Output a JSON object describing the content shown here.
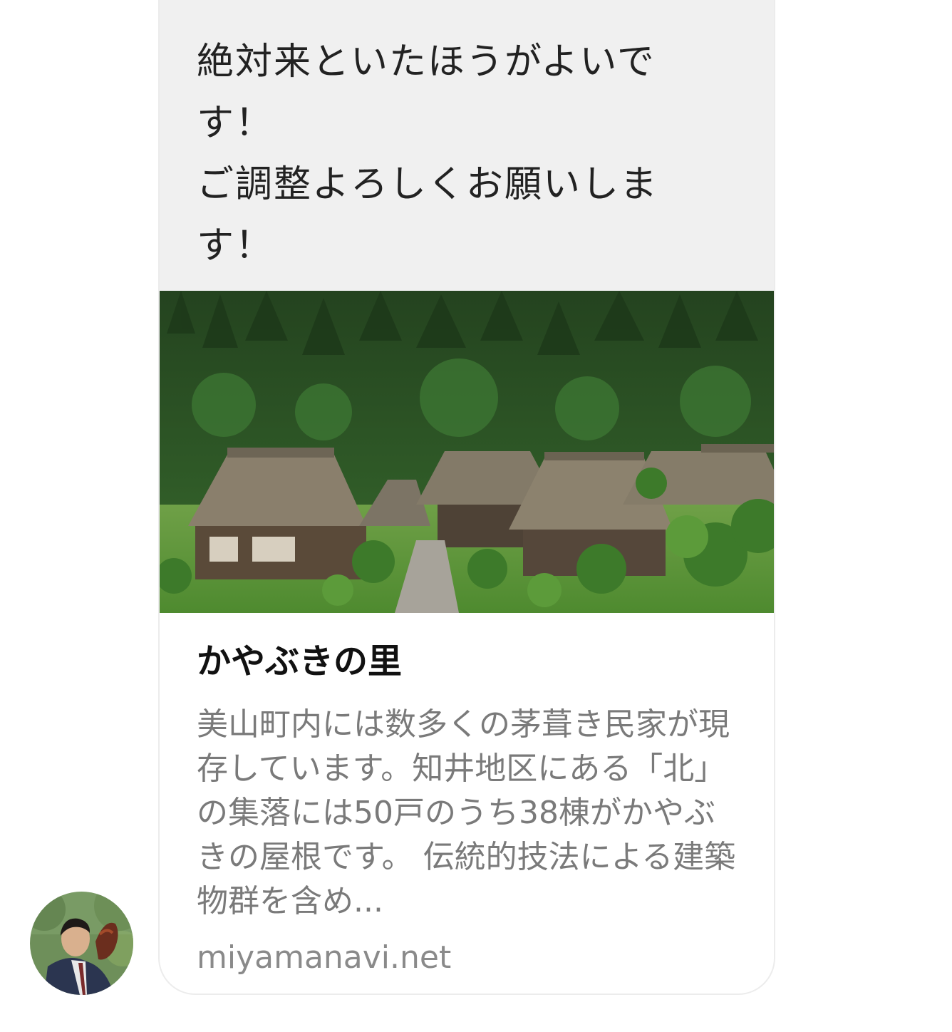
{
  "message": {
    "text": "絶対来といたほうがよいで\nす！\nご調整よろしくお願いしま\nす！"
  },
  "link_preview": {
    "image_alt": "thatched-roof village in forest",
    "title": "かやぶきの里",
    "description": "美山町内には数多くの茅葺き民家が現存しています。知井地区にある「北」の集落には50戸のうち38棟がかやぶきの屋根です。 伝統的技法による建築物群を含め...",
    "domain": "miyamanavi.net"
  },
  "avatar": {
    "label": "sender avatar"
  },
  "colors": {
    "bubble_background": "#f0f0f0",
    "card_border": "#ececec",
    "title_text": "#111111",
    "description_text": "#7a7a7a",
    "domain_text": "#8a8a8a"
  }
}
